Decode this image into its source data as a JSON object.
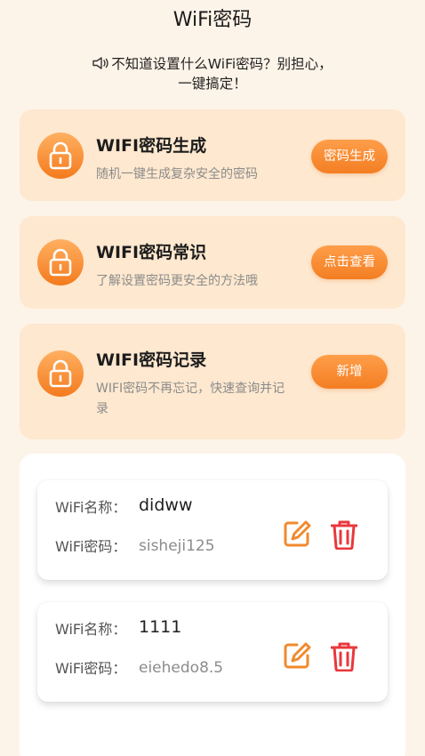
{
  "header": {
    "title": "WiFi密码"
  },
  "notice": {
    "line1": "不知道设置什么WiFi密码？别担心，",
    "line2": "一键搞定！",
    "icon": "speaker-icon"
  },
  "cards": [
    {
      "title": "WIFI密码生成",
      "desc": "随机一键生成复杂安全的密码",
      "button": "密码生成",
      "icon": "lock-icon"
    },
    {
      "title": "WIFI密码常识",
      "desc": "了解设置密码更安全的方法哦",
      "button": "点击查看",
      "icon": "lock-icon"
    },
    {
      "title": "WIFI密码记录",
      "desc": "WIFI密码不再忘记，快速查询并记录",
      "button": "新增",
      "icon": "lock-icon"
    }
  ],
  "records": {
    "name_label": "WiFi名称：",
    "pwd_label": "WiFi密码：",
    "items": [
      {
        "name": "didww",
        "password": "sisheji125"
      },
      {
        "name": "1111",
        "password": "eiehedo8.5"
      }
    ]
  },
  "colors": {
    "accent": "#F37E22",
    "danger": "#E8383D",
    "background": "#FDF4E9",
    "card": "#FEE8CF"
  }
}
